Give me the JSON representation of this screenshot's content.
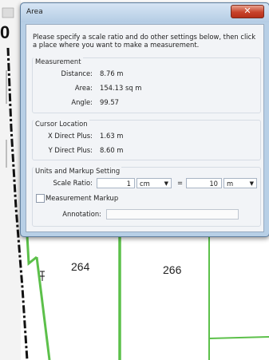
{
  "background": {
    "left_digit": "0",
    "lot_labels": [
      "264",
      "266"
    ]
  },
  "dialog": {
    "title": "Area",
    "close_glyph": "✕",
    "instructions": "Please specify a scale ratio and do other settings below, then click a place where you want to make a measurement.",
    "measurement": {
      "title": "Measurement",
      "distance_label": "Distance:",
      "distance_value": "8.76 m",
      "area_label": "Area:",
      "area_value": "154.13 sq m",
      "angle_label": "Angle:",
      "angle_value": "99.57"
    },
    "cursor": {
      "title": "Cursor Location",
      "x_label": "X Direct Plus:",
      "x_value": "1.63 m",
      "y_label": "Y Direct Plus:",
      "y_value": "8.60 m"
    },
    "units": {
      "title": "Units and Markup Setting",
      "scale_label": "Scale Ratio:",
      "scale_left_value": "1",
      "scale_left_unit": "cm",
      "equals": "=",
      "scale_right_value": "10",
      "scale_right_unit": "m",
      "markup_label": "Measurement Markup",
      "markup_checked": false,
      "annotation_label": "Annotation:",
      "annotation_value": ""
    }
  },
  "colors": {
    "lot_line": "#5cc04a",
    "dash_line": "#111111"
  }
}
